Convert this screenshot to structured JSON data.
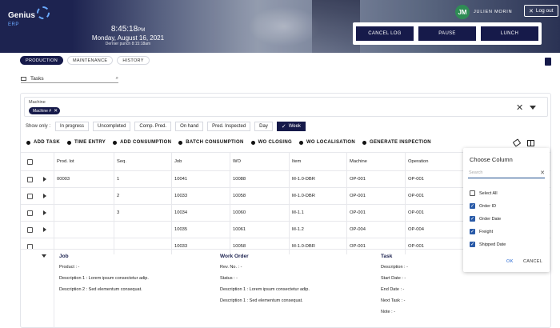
{
  "header": {
    "logo_text": "Genius",
    "logo_sub": "ERP",
    "time": "8:45:18",
    "time_suffix": "PM",
    "date": "Monday, August 16, 2021",
    "last_punch": "Dernier punch 8:15:18am",
    "user_initials": "JM",
    "user_name": "JULIEN MORIN",
    "logout_label": "Log out",
    "actions": [
      "CANCEL LOG",
      "PAUSE",
      "LUNCH"
    ]
  },
  "tabs": [
    "PRODUCTION",
    "MAINTENANCE",
    "HISTORY"
  ],
  "tasks_search": {
    "label": "Tasks"
  },
  "machine": {
    "label": "Machine",
    "chip": "Machine #"
  },
  "filters": {
    "show_only": "Show only :",
    "buttons": [
      "In progress",
      "Uncompleted",
      "Comp. Pred.",
      "On hand",
      "Pred. Inspected",
      "Day",
      "Week"
    ]
  },
  "actions_bar": [
    "ADD TASK",
    "TIME ENTRY",
    "ADD CONSUMPTION",
    "BATCH CONSUMPTION",
    "WO CLOSING",
    "WO LOCALISATION",
    "GENERATE INSPECTION"
  ],
  "table": {
    "columns": [
      "Prod. lot",
      "Seq.",
      "Job",
      "WO",
      "Item",
      "Machine",
      "Operation"
    ],
    "rows": [
      [
        "00003",
        "1",
        "10041",
        "10088",
        "M-1.0-DBR",
        "OP-001",
        "OP-001"
      ],
      [
        "",
        "2",
        "10033",
        "10058",
        "M-1.0-DBR",
        "OP-001",
        "OP-001"
      ],
      [
        "",
        "3",
        "10034",
        "10060",
        "M-1.1",
        "OP-001",
        "OP-001"
      ],
      [
        "",
        "",
        "10035",
        "10061",
        "M-1.2",
        "OP-004",
        "OP-004"
      ],
      [
        "",
        "",
        "10033",
        "10058",
        "M-1.0-DBR",
        "OP-001",
        "OP-001"
      ]
    ]
  },
  "details": {
    "job": {
      "title": "Job",
      "lines": [
        "Product : -",
        "Description 1 : Lorem ipsum consectetur adip.",
        "Description 2 : Sed elementum consequat."
      ]
    },
    "work_order": {
      "title": "Work Order",
      "lines": [
        "Rev. No. : -",
        "Status : -",
        "Description 1 : Lorem ipsum consectetur adip.",
        "Description 1 : Sed elementum consequat."
      ]
    },
    "task": {
      "title": "Task",
      "lines": [
        "Description : -",
        "Start Date : -",
        "End Date : -",
        "Next Task : -",
        "Note : -"
      ]
    }
  },
  "choose_column": {
    "title": "Choose Column",
    "search_placeholder": "Search",
    "select_all": "Select All",
    "options": [
      "Order ID",
      "Order Date",
      "Freight",
      "Shipped Date"
    ],
    "ok": "OK",
    "cancel": "CANCEL"
  }
}
